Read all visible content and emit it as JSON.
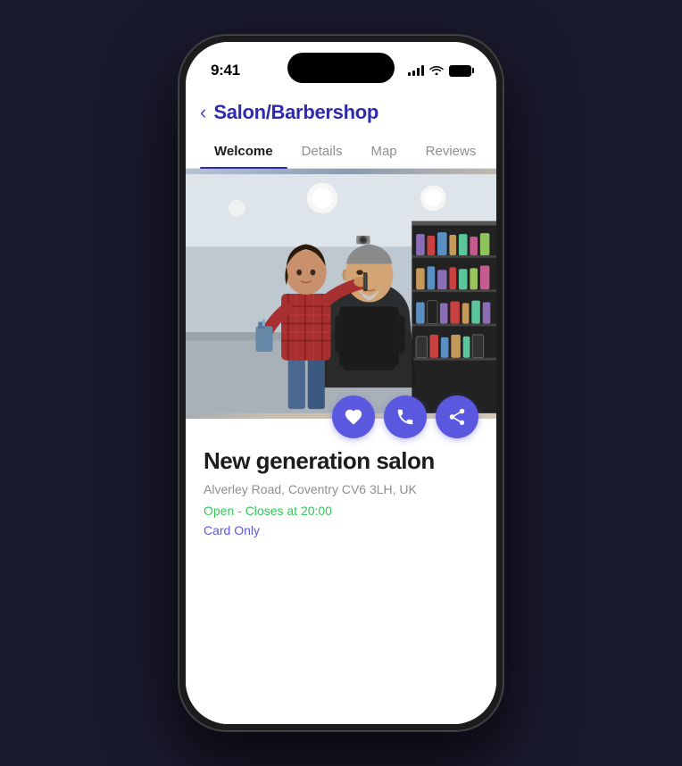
{
  "status_bar": {
    "time": "9:41"
  },
  "nav": {
    "back_label": "‹",
    "title": "Salon/Barbershop"
  },
  "tabs": [
    {
      "id": "welcome",
      "label": "Welcome",
      "active": true
    },
    {
      "id": "details",
      "label": "Details",
      "active": false
    },
    {
      "id": "map",
      "label": "Map",
      "active": false
    },
    {
      "id": "reviews",
      "label": "Reviews",
      "active": false
    }
  ],
  "action_buttons": [
    {
      "id": "favorite",
      "icon": "heart"
    },
    {
      "id": "call",
      "icon": "phone"
    },
    {
      "id": "share",
      "icon": "share"
    }
  ],
  "salon": {
    "name": "New generation salon",
    "address": "Alverley Road, Coventry CV6 3LH, UK",
    "status": "Open - Closes at 20:00",
    "payment": "Card Only"
  },
  "colors": {
    "accent": "#5b58e0",
    "nav_title": "#2d2aad",
    "status_open": "#34c759",
    "tab_active": "#1c1c1e"
  }
}
